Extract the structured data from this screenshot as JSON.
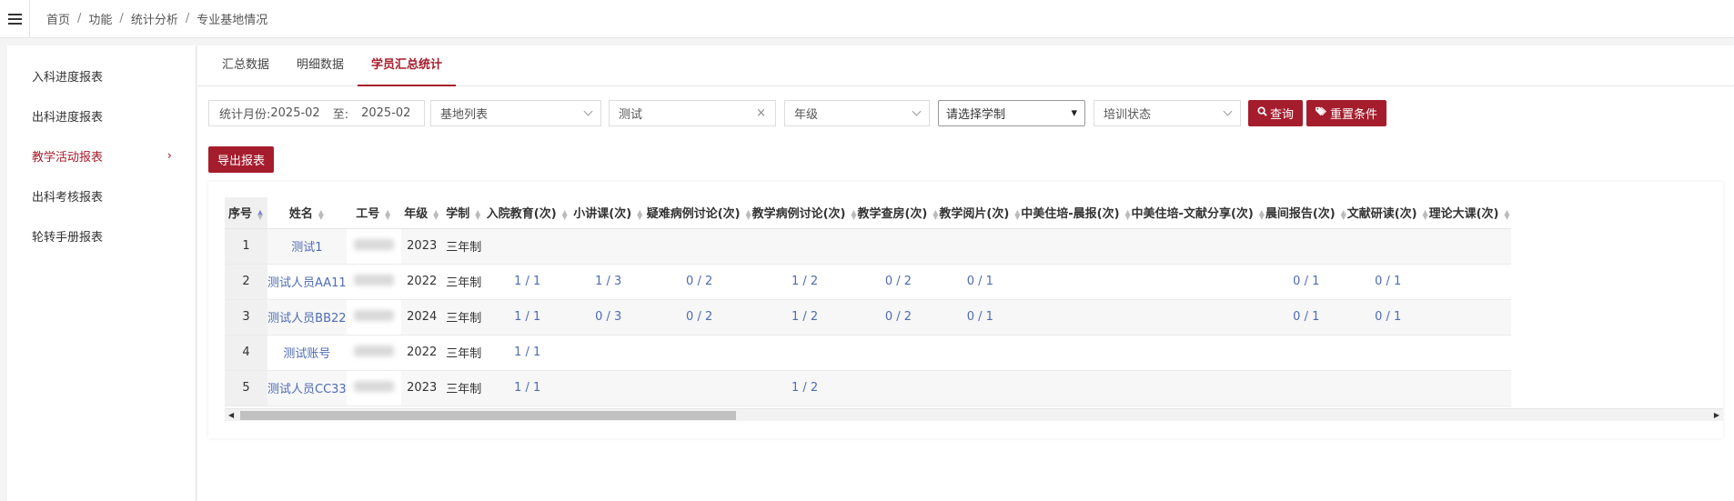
{
  "breadcrumb": [
    "首页",
    "功能",
    "统计分析",
    "专业基地情况"
  ],
  "breadcrumb_sep": "/",
  "sidebar": {
    "items": [
      {
        "label": "入科进度报表"
      },
      {
        "label": "出科进度报表"
      },
      {
        "label": "教学活动报表",
        "chevron": "›"
      },
      {
        "label": "出科考核报表"
      },
      {
        "label": "轮转手册报表"
      }
    ],
    "active_index": 2
  },
  "tabs": [
    {
      "label": "汇总数据"
    },
    {
      "label": "明细数据"
    },
    {
      "label": "学员汇总统计"
    }
  ],
  "active_tab": 2,
  "filters": {
    "month_label": "统计月份:",
    "month_start": "2025-02",
    "month_to": "至:",
    "month_end": "2025-02",
    "base_placeholder": "基地列表",
    "search_value": "测试",
    "clear_icon": "×",
    "grade_placeholder": "年级",
    "system_value": "请选择学制",
    "system_arrow": "▾",
    "status_placeholder": "培训状态",
    "query_label": "查询",
    "reset_label": "重置条件"
  },
  "export_label": "导出报表",
  "table": {
    "columns": [
      "序号",
      "姓名",
      "工号",
      "年级",
      "学制",
      "入院教育(次)",
      "小讲课(次)",
      "疑难病例讨论(次)",
      "教学病例讨论(次)",
      "教学查房(次)",
      "教学阅片(次)",
      "中美住培-晨报(次)",
      "中美住培-文献分享(次)",
      "晨间报告(次)",
      "文献研读(次)",
      "理论大课(次)"
    ],
    "rows": [
      [
        "1",
        "测试1",
        "",
        "2023",
        "三年制",
        "",
        "",
        "",
        "",
        "",
        "",
        "",
        "",
        "",
        "",
        ""
      ],
      [
        "2",
        "测试人员AA11",
        "",
        "2022",
        "三年制",
        "1 / 1",
        "1 / 3",
        "0 / 2",
        "1 / 2",
        "0 / 2",
        "0 / 1",
        "",
        "",
        "0 / 1",
        "0 / 1",
        ""
      ],
      [
        "3",
        "测试人员BB22",
        "",
        "2024",
        "三年制",
        "1 / 1",
        "0 / 3",
        "0 / 2",
        "1 / 2",
        "0 / 2",
        "0 / 1",
        "",
        "",
        "0 / 1",
        "0 / 1",
        ""
      ],
      [
        "4",
        "测试账号",
        "",
        "2022",
        "三年制",
        "1 / 1",
        "",
        "",
        "",
        "",
        "",
        "",
        "",
        "",
        "",
        ""
      ],
      [
        "5",
        "测试人员CC33",
        "",
        "2023",
        "三年制",
        "1 / 1",
        "",
        "",
        "1 / 2",
        "",
        "",
        "",
        "",
        "",
        "",
        ""
      ]
    ]
  },
  "colors": {
    "accent": "#a51d2d",
    "link": "#4e6bb5"
  }
}
